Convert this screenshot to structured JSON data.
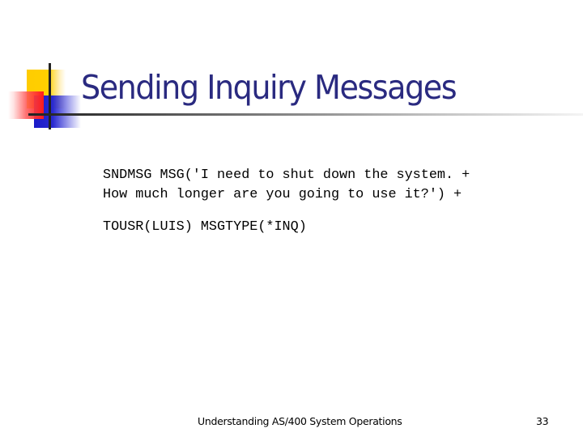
{
  "slide": {
    "title": "Sending Inquiry Messages",
    "body_lines": [
      "SNDMSG MSG('I need to shut down the system. +",
      "How much longer are you going to use it?') +",
      "TOUSR(LUIS) MSGTYPE(*INQ)"
    ],
    "footer": "Understanding AS/400 System Operations",
    "page_number": "33"
  },
  "colors": {
    "title": "#2a2a80",
    "accent_yellow": "#ffcc00",
    "accent_blue": "#1a1ac8",
    "accent_red": "#ff1a1a"
  }
}
